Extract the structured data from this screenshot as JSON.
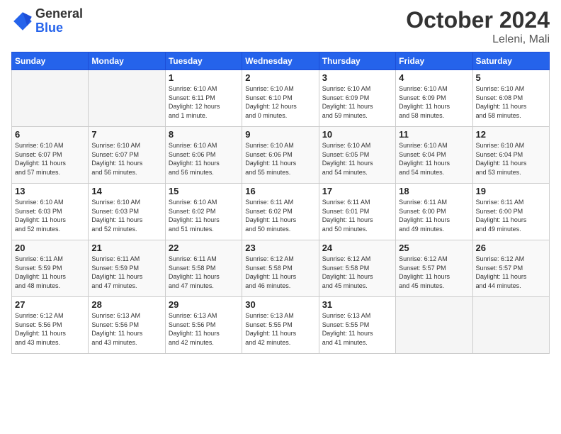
{
  "logo": {
    "general": "General",
    "blue": "Blue"
  },
  "title": "October 2024",
  "location": "Leleni, Mali",
  "days_header": [
    "Sunday",
    "Monday",
    "Tuesday",
    "Wednesday",
    "Thursday",
    "Friday",
    "Saturday"
  ],
  "weeks": [
    [
      {
        "day": "",
        "info": ""
      },
      {
        "day": "",
        "info": ""
      },
      {
        "day": "1",
        "info": "Sunrise: 6:10 AM\nSunset: 6:11 PM\nDaylight: 12 hours\nand 1 minute."
      },
      {
        "day": "2",
        "info": "Sunrise: 6:10 AM\nSunset: 6:10 PM\nDaylight: 12 hours\nand 0 minutes."
      },
      {
        "day": "3",
        "info": "Sunrise: 6:10 AM\nSunset: 6:09 PM\nDaylight: 11 hours\nand 59 minutes."
      },
      {
        "day": "4",
        "info": "Sunrise: 6:10 AM\nSunset: 6:09 PM\nDaylight: 11 hours\nand 58 minutes."
      },
      {
        "day": "5",
        "info": "Sunrise: 6:10 AM\nSunset: 6:08 PM\nDaylight: 11 hours\nand 58 minutes."
      }
    ],
    [
      {
        "day": "6",
        "info": "Sunrise: 6:10 AM\nSunset: 6:07 PM\nDaylight: 11 hours\nand 57 minutes."
      },
      {
        "day": "7",
        "info": "Sunrise: 6:10 AM\nSunset: 6:07 PM\nDaylight: 11 hours\nand 56 minutes."
      },
      {
        "day": "8",
        "info": "Sunrise: 6:10 AM\nSunset: 6:06 PM\nDaylight: 11 hours\nand 56 minutes."
      },
      {
        "day": "9",
        "info": "Sunrise: 6:10 AM\nSunset: 6:06 PM\nDaylight: 11 hours\nand 55 minutes."
      },
      {
        "day": "10",
        "info": "Sunrise: 6:10 AM\nSunset: 6:05 PM\nDaylight: 11 hours\nand 54 minutes."
      },
      {
        "day": "11",
        "info": "Sunrise: 6:10 AM\nSunset: 6:04 PM\nDaylight: 11 hours\nand 54 minutes."
      },
      {
        "day": "12",
        "info": "Sunrise: 6:10 AM\nSunset: 6:04 PM\nDaylight: 11 hours\nand 53 minutes."
      }
    ],
    [
      {
        "day": "13",
        "info": "Sunrise: 6:10 AM\nSunset: 6:03 PM\nDaylight: 11 hours\nand 52 minutes."
      },
      {
        "day": "14",
        "info": "Sunrise: 6:10 AM\nSunset: 6:03 PM\nDaylight: 11 hours\nand 52 minutes."
      },
      {
        "day": "15",
        "info": "Sunrise: 6:10 AM\nSunset: 6:02 PM\nDaylight: 11 hours\nand 51 minutes."
      },
      {
        "day": "16",
        "info": "Sunrise: 6:11 AM\nSunset: 6:02 PM\nDaylight: 11 hours\nand 50 minutes."
      },
      {
        "day": "17",
        "info": "Sunrise: 6:11 AM\nSunset: 6:01 PM\nDaylight: 11 hours\nand 50 minutes."
      },
      {
        "day": "18",
        "info": "Sunrise: 6:11 AM\nSunset: 6:00 PM\nDaylight: 11 hours\nand 49 minutes."
      },
      {
        "day": "19",
        "info": "Sunrise: 6:11 AM\nSunset: 6:00 PM\nDaylight: 11 hours\nand 49 minutes."
      }
    ],
    [
      {
        "day": "20",
        "info": "Sunrise: 6:11 AM\nSunset: 5:59 PM\nDaylight: 11 hours\nand 48 minutes."
      },
      {
        "day": "21",
        "info": "Sunrise: 6:11 AM\nSunset: 5:59 PM\nDaylight: 11 hours\nand 47 minutes."
      },
      {
        "day": "22",
        "info": "Sunrise: 6:11 AM\nSunset: 5:58 PM\nDaylight: 11 hours\nand 47 minutes."
      },
      {
        "day": "23",
        "info": "Sunrise: 6:12 AM\nSunset: 5:58 PM\nDaylight: 11 hours\nand 46 minutes."
      },
      {
        "day": "24",
        "info": "Sunrise: 6:12 AM\nSunset: 5:58 PM\nDaylight: 11 hours\nand 45 minutes."
      },
      {
        "day": "25",
        "info": "Sunrise: 6:12 AM\nSunset: 5:57 PM\nDaylight: 11 hours\nand 45 minutes."
      },
      {
        "day": "26",
        "info": "Sunrise: 6:12 AM\nSunset: 5:57 PM\nDaylight: 11 hours\nand 44 minutes."
      }
    ],
    [
      {
        "day": "27",
        "info": "Sunrise: 6:12 AM\nSunset: 5:56 PM\nDaylight: 11 hours\nand 43 minutes."
      },
      {
        "day": "28",
        "info": "Sunrise: 6:13 AM\nSunset: 5:56 PM\nDaylight: 11 hours\nand 43 minutes."
      },
      {
        "day": "29",
        "info": "Sunrise: 6:13 AM\nSunset: 5:56 PM\nDaylight: 11 hours\nand 42 minutes."
      },
      {
        "day": "30",
        "info": "Sunrise: 6:13 AM\nSunset: 5:55 PM\nDaylight: 11 hours\nand 42 minutes."
      },
      {
        "day": "31",
        "info": "Sunrise: 6:13 AM\nSunset: 5:55 PM\nDaylight: 11 hours\nand 41 minutes."
      },
      {
        "day": "",
        "info": ""
      },
      {
        "day": "",
        "info": ""
      }
    ]
  ]
}
